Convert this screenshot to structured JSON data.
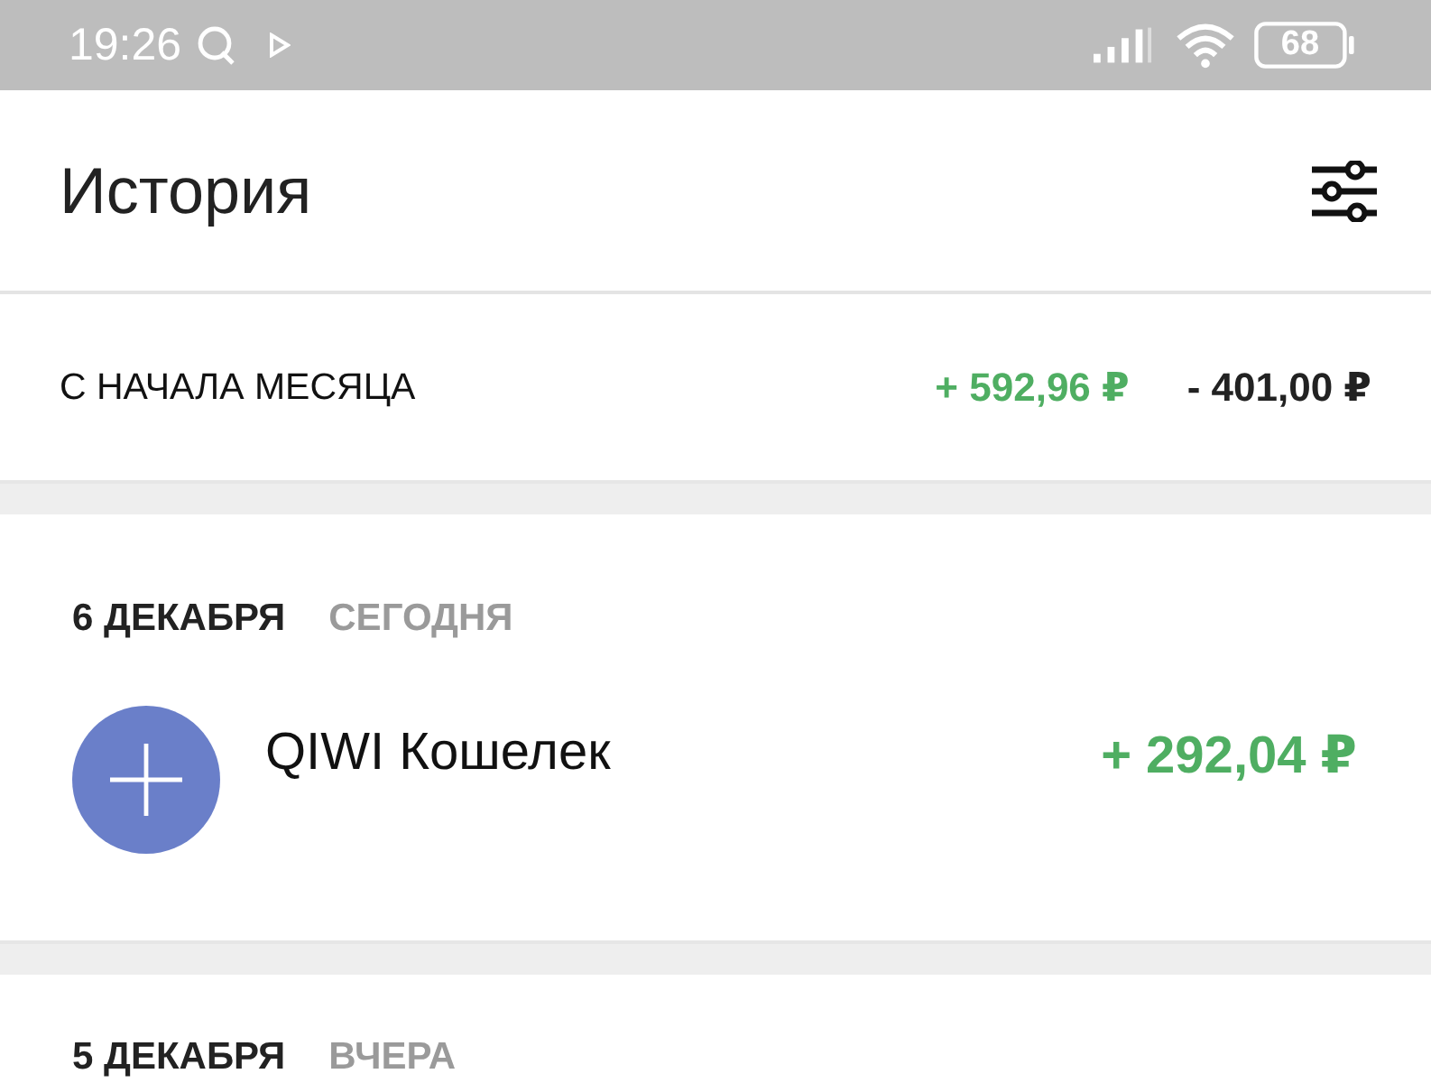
{
  "status_bar": {
    "time": "19:26",
    "battery": "68"
  },
  "header": {
    "title": "История"
  },
  "summary": {
    "label": "С НАЧАЛА МЕСЯЦА",
    "income": "+ 592,96 ₽",
    "expense": "- 401,00 ₽"
  },
  "days": [
    {
      "date": "6 ДЕКАБРЯ",
      "relative": "СЕГОДНЯ",
      "transactions": [
        {
          "name": "QIWI Кошелек",
          "amount": "+ 292,04 ₽",
          "kind": "income"
        }
      ]
    },
    {
      "date": "5 ДЕКАБРЯ",
      "relative": "ВЧЕРА"
    }
  ]
}
